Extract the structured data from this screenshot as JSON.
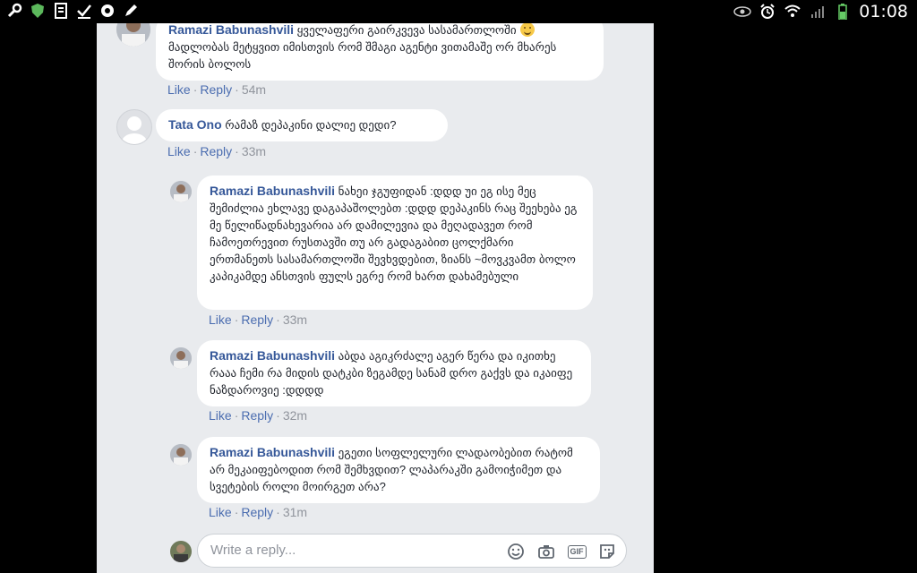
{
  "status_bar": {
    "time": "01:08"
  },
  "comments": [
    {
      "author": "Ramazi Babunashvili",
      "text_line1": "ყველაფერი გაირკვევა სასამართლოში",
      "text_rest": "მადლობას მეტყვით იმისთვის რომ შმაგი აგენტი ვითამაშე ორ მხარეს შორის ბოლოს",
      "like": "Like",
      "reply": "Reply",
      "time": "54m"
    },
    {
      "author": "Tata Ono",
      "text": "რამაზ დეპაკინი დალიე დედი?",
      "like": "Like",
      "reply": "Reply",
      "time": "33m"
    },
    {
      "author": "Ramazi Babunashvili",
      "text": "ნახეი ჯგუფიდან :დდდ უი ეგ ისე მეც შემიძლია ეხლავე დაგაპაშოლებთ :დდდ დეპაკინს რაც შეეხება ეგ მე წელიწადნახევარია არ დამილევია და მეღადავეთ რომ ჩამოეთრევით რუსთავში თუ არ გადაგაბით ცოლქმარი ერთმანეთს სასამართლოში შევხვდებით, ზიანს ~მოვკვამთ ბოლო კაპიკამდე ანსთვის ფულს ეგრე რომ ხართ დახამებული",
      "like": "Like",
      "reply": "Reply",
      "time": "33m"
    },
    {
      "author": "Ramazi Babunashvili",
      "text": "აბდა აგიკრძალე აგერ წერა და იკითხე რააა ჩემი რა მიდის დატკბი ზეგამდე სანამ დრო გაქვს და იკაიფე ნაზდაროვიე :დდდდ",
      "like": "Like",
      "reply": "Reply",
      "time": "32m"
    },
    {
      "author": "Ramazi Babunashvili",
      "text": "ეგეთი სოფლელური ლადაობებით რატომ არ მეკაიფებოდით რომ შემხვდით? ლაპარაკში გამოიჭიმეთ და სვეტების როლი მოირგეთ არა?",
      "like": "Like",
      "reply": "Reply",
      "time": "31m"
    }
  ],
  "reply_box": {
    "placeholder": "Write a reply...",
    "icons": [
      "smiley-icon",
      "camera-icon",
      "gif-icon",
      "sticker-icon"
    ],
    "gif_label": "GIF"
  },
  "colors": {
    "link": "#4b6db0",
    "author": "#365899",
    "panel_bg": "#e9ebee",
    "bubble_bg": "#ffffff"
  }
}
